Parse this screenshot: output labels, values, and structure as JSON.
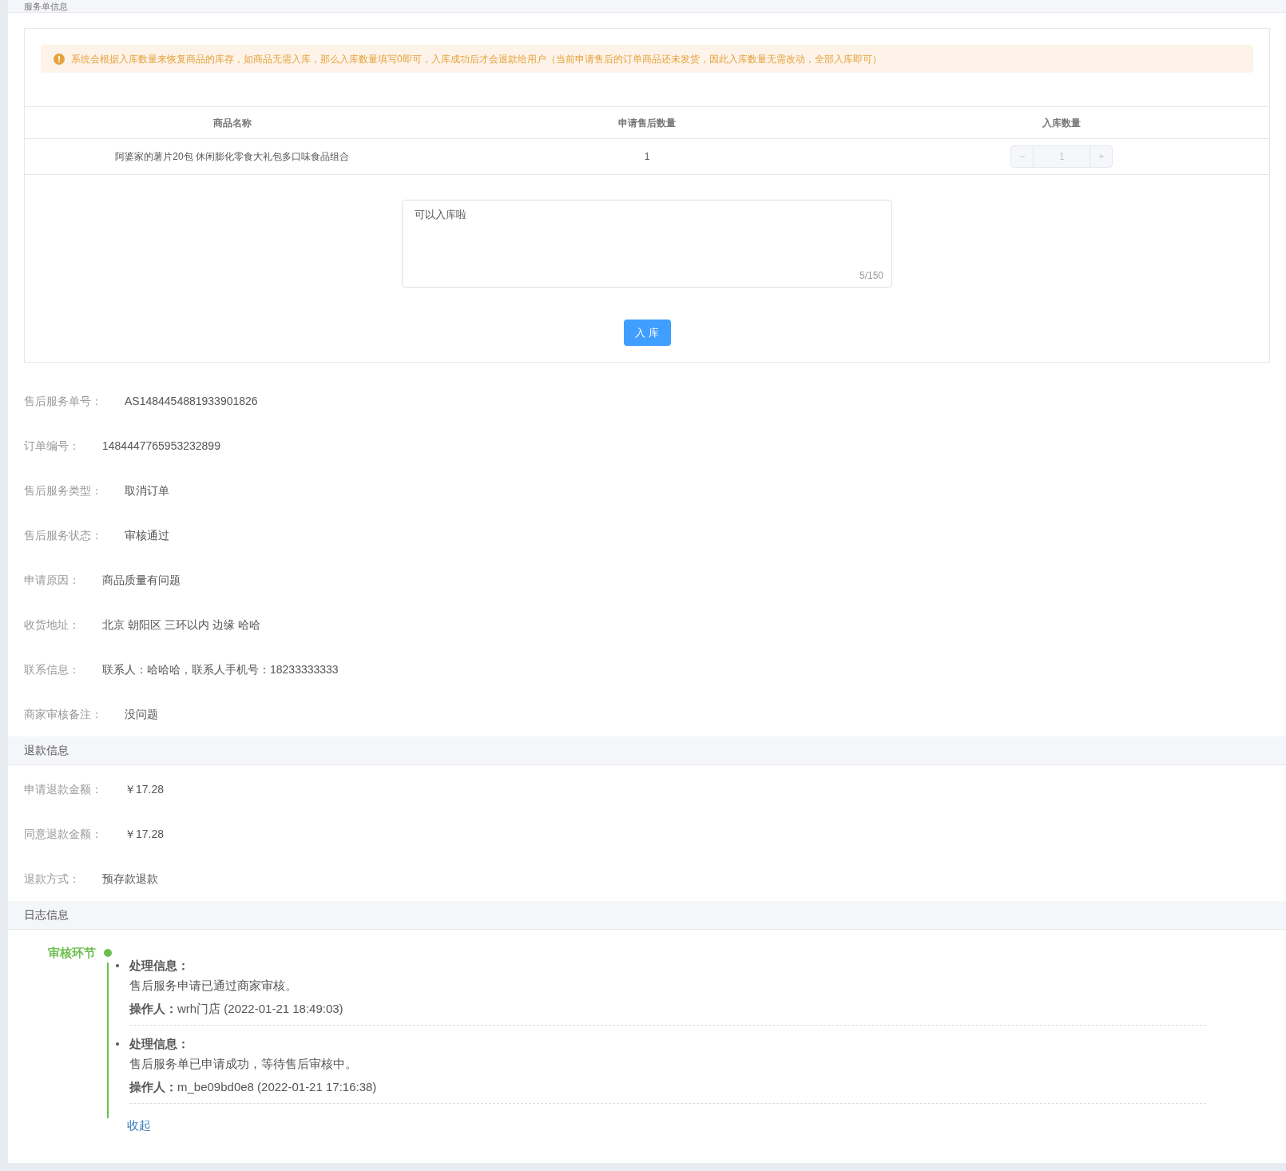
{
  "header": {
    "title": "服务单信息"
  },
  "alert": {
    "text": "系统会根据入库数量来恢复商品的库存，如商品无需入库，那么入库数量填写0即可，入库成功后才会退款给用户（当前申请售后的订单商品还未发货，因此入库数量无需改动，全部入库即可）"
  },
  "table": {
    "columns": [
      "商品名称",
      "申请售后数量",
      "入库数量"
    ],
    "rows": [
      {
        "name": "阿婆家的薯片20包 休闲膨化零食大礼包多口味食品组合",
        "quantity": "1",
        "stepper": {
          "minus": "−",
          "value": "1",
          "plus": "+",
          "disabled": true
        }
      }
    ]
  },
  "remark": {
    "value": "可以入库啦",
    "counter": "5/150"
  },
  "submit_button": "入 库",
  "info": [
    {
      "label": "售后服务单号：",
      "value": "AS1484454881933901826"
    },
    {
      "label": "订单编号：",
      "value": "1484447765953232899"
    },
    {
      "label": "售后服务类型：",
      "value": "取消订单"
    },
    {
      "label": "售后服务状态：",
      "value": "审核通过"
    },
    {
      "label": "申请原因：",
      "value": "商品质量有问题"
    },
    {
      "label": "收货地址：",
      "value": "北京 朝阳区 三环以内 边缘 哈哈"
    },
    {
      "label": "联系信息：",
      "value": "联系人：哈哈哈，联系人手机号：18233333333"
    },
    {
      "label": "商家审核备注：",
      "value": "没问题"
    }
  ],
  "refund": {
    "title": "退款信息",
    "rows": [
      {
        "label": "申请退款金额：",
        "value": "￥17.28"
      },
      {
        "label": "同意退款金额：",
        "value": "￥17.28"
      },
      {
        "label": "退款方式：",
        "value": "预存款退款"
      }
    ]
  },
  "log": {
    "title": "日志信息",
    "stage": "审核环节",
    "color": "#6cbf4e",
    "entries": [
      {
        "heading": "处理信息：",
        "message": "售后服务申请已通过商家审核。",
        "operator": "**操作人：**wrh门店 (2022-01-21 18:49:03)"
      },
      {
        "heading": "处理信息：",
        "message": "售后服务单已申请成功，等待售后审核中。",
        "operator": "**操作人：**m_be09bd0e8 (2022-01-21 17:16:38)"
      }
    ],
    "collapse": "收起"
  }
}
